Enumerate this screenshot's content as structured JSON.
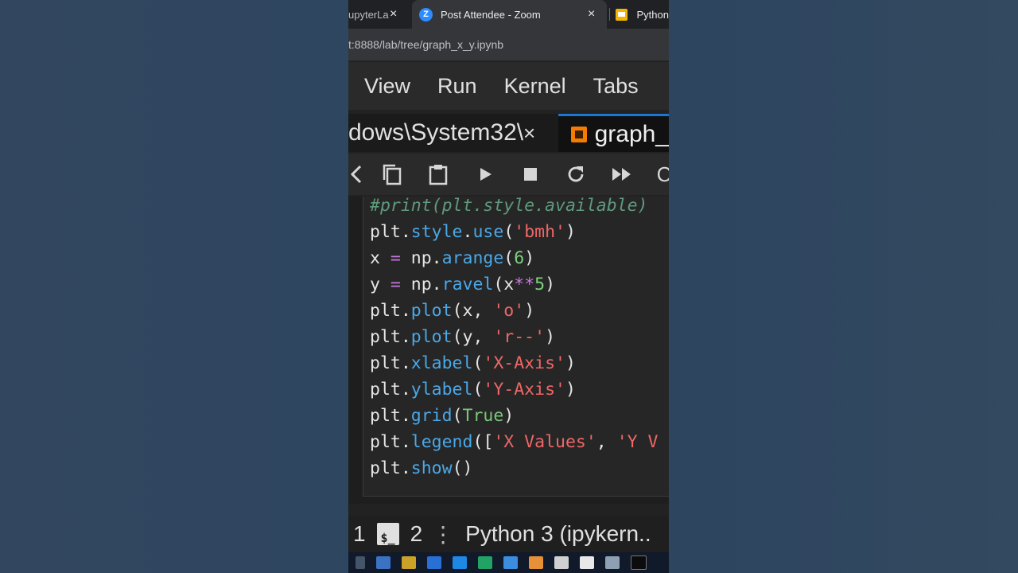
{
  "browser": {
    "tabs": [
      {
        "label": "upyterLa",
        "close": "×"
      },
      {
        "label": "Post Attendee - Zoom",
        "icon_letter": "Z",
        "close": "×"
      },
      {
        "label": "Python"
      }
    ],
    "address": "t:8888/lab/tree/graph_x_y.ipynb"
  },
  "menu": {
    "items": [
      "View",
      "Run",
      "Kernel",
      "Tabs"
    ]
  },
  "doc_tabs": [
    {
      "label": "dows\\System32\\",
      "close": "×"
    },
    {
      "label": "graph_"
    }
  ],
  "toolbar": {
    "icons": [
      "cut-icon",
      "copy-icon",
      "paste-icon",
      "run-icon",
      "stop-icon",
      "restart-icon",
      "fast-forward-icon"
    ],
    "trailing_text": "C"
  },
  "code": {
    "lines": [
      [
        {
          "t": "#print(plt.style.available)",
          "c": "comment"
        }
      ],
      [
        {
          "t": "plt."
        },
        {
          "t": "style",
          "c": "attr"
        },
        {
          "t": "."
        },
        {
          "t": "use",
          "c": "attr"
        },
        {
          "t": "("
        },
        {
          "t": "'bmh'",
          "c": "str"
        },
        {
          "t": ")"
        }
      ],
      [
        {
          "t": "x "
        },
        {
          "t": "=",
          "c": "op"
        },
        {
          "t": " np."
        },
        {
          "t": "arange",
          "c": "attr"
        },
        {
          "t": "("
        },
        {
          "t": "6",
          "c": "num"
        },
        {
          "t": ")"
        }
      ],
      [
        {
          "t": "y "
        },
        {
          "t": "=",
          "c": "op"
        },
        {
          "t": " np."
        },
        {
          "t": "ravel",
          "c": "attr"
        },
        {
          "t": "(x"
        },
        {
          "t": "**",
          "c": "op"
        },
        {
          "t": "5",
          "c": "num"
        },
        {
          "t": ")"
        }
      ],
      [
        {
          "t": "plt."
        },
        {
          "t": "plot",
          "c": "attr"
        },
        {
          "t": "(x, "
        },
        {
          "t": "'o'",
          "c": "str"
        },
        {
          "t": ")"
        }
      ],
      [
        {
          "t": "plt."
        },
        {
          "t": "plot",
          "c": "attr"
        },
        {
          "t": "(y, "
        },
        {
          "t": "'r--'",
          "c": "str"
        },
        {
          "t": ")"
        }
      ],
      [
        {
          "t": "plt."
        },
        {
          "t": "xlabel",
          "c": "attr"
        },
        {
          "t": "("
        },
        {
          "t": "'X-Axis'",
          "c": "str"
        },
        {
          "t": ")"
        }
      ],
      [
        {
          "t": "plt."
        },
        {
          "t": "ylabel",
          "c": "attr"
        },
        {
          "t": "("
        },
        {
          "t": "'Y-Axis'",
          "c": "str"
        },
        {
          "t": ")"
        }
      ],
      [
        {
          "t": "plt."
        },
        {
          "t": "grid",
          "c": "attr"
        },
        {
          "t": "("
        },
        {
          "t": "True",
          "c": "kw"
        },
        {
          "t": ")"
        }
      ],
      [
        {
          "t": "plt."
        },
        {
          "t": "legend",
          "c": "attr"
        },
        {
          "t": "(["
        },
        {
          "t": "'X Values'",
          "c": "str"
        },
        {
          "t": ", "
        },
        {
          "t": "'Y V",
          "c": "str"
        }
      ],
      [
        {
          "t": "plt."
        },
        {
          "t": "show",
          "c": "attr"
        },
        {
          "t": "()"
        }
      ]
    ]
  },
  "status": {
    "count_a": "1",
    "terminal_icon": "$_",
    "count_b": "2",
    "kernel": "Python 3 (ipykern.."
  },
  "colors": {
    "accent": "#1976d2",
    "notebook_icon": "#f57c00",
    "zoom": "#2d8cff"
  }
}
